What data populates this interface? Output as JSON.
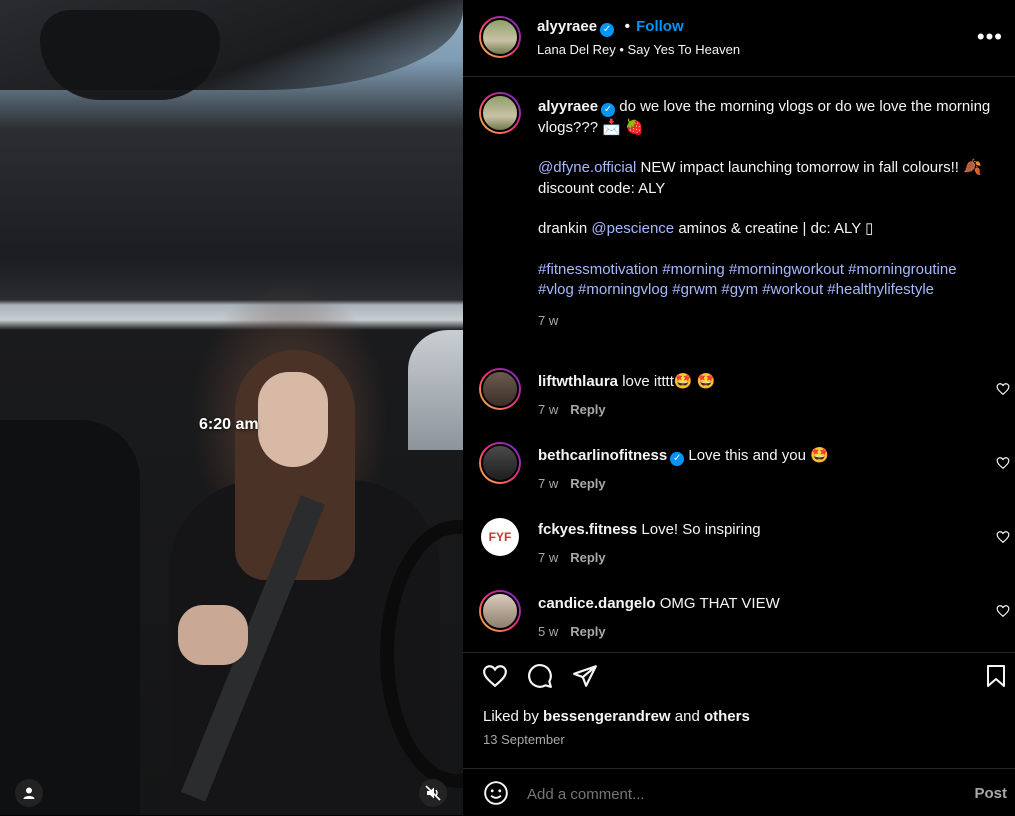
{
  "media": {
    "overlay_time": "6:20 am"
  },
  "header": {
    "username": "alyyraee",
    "follow": "Follow",
    "song": "Lana Del Rey • Say Yes To Heaven"
  },
  "caption": {
    "username": "alyyraee",
    "line1": "do we love the morning vlogs or do we love the morning vlogs??? 📩 🍓",
    "mention1": "@dfyne.official",
    "line2": " NEW impact launching tomorrow in fall colours!! 🍂 discount code: ALY",
    "line3_pre": "drankin ",
    "mention2": "@pescience",
    "line3_post": " aminos & creatine | dc: ALY ▯",
    "hashtags": "#fitnessmotivation #morning #morningworkout #morningroutine #vlog #morningvlog #grwm #gym #workout #healthylifestyle",
    "age": "7 w"
  },
  "comments": [
    {
      "user": "liftwthlaura",
      "verified": false,
      "text": "love itttt🤩 🤩",
      "age": "7 w",
      "reply": "Reply"
    },
    {
      "user": "bethcarlinofitness",
      "verified": true,
      "text": "Love this and you 🤩",
      "age": "7 w",
      "reply": "Reply"
    },
    {
      "user": "fckyes.fitness",
      "verified": false,
      "text": "Love! So inspiring",
      "age": "7 w",
      "reply": "Reply",
      "avatar_text": "FYF"
    },
    {
      "user": "candice.dangelo",
      "verified": false,
      "text": "OMG THAT VIEW",
      "age": "5 w",
      "reply": "Reply"
    }
  ],
  "likes": {
    "prefix": "Liked by ",
    "user": "bessengerandrew",
    "mid": " and ",
    "others": "others"
  },
  "date": "13 September",
  "comment_box": {
    "placeholder": "Add a comment...",
    "post": "Post"
  },
  "colors": {
    "accent": "#0095f6",
    "mention": "#a5b8ff",
    "muted": "#a8a8a8"
  }
}
